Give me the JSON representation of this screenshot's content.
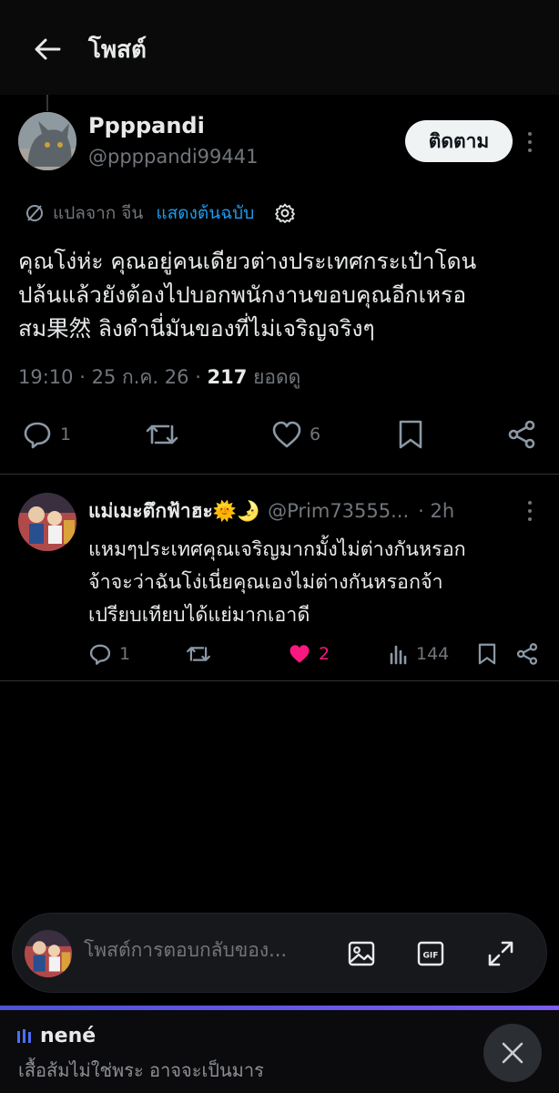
{
  "header": {
    "title": "โพสต์",
    "back_icon": "arrow-left-icon"
  },
  "post": {
    "author_name": "Ppppandi",
    "author_handle": "@ppppandi99441",
    "follow_label": "ติดตาม",
    "translate": {
      "from_label": "แปลจาก จีน",
      "show_original_label": "แสดงต้นฉบับ"
    },
    "text": "คุณโง่ห่ะ คุณอยู่คนเดียวต่างประเทศกระเป๋าโดน\nปล้นแล้วยังต้องไปบอกพนักงานขอบคุณอีกเหรอ\nสม果然 ลิงดำนี่มันของที่ไม่เจริญจริงๆ",
    "time": "19:10",
    "date": "25 ก.ค. 26",
    "views_count": "217",
    "views_label": "ยอดดู",
    "actions": {
      "reply_count": "1",
      "like_count": "6"
    }
  },
  "reply": {
    "author_name": "แม่เมะตึกฟ้าฮะ🌞🌛",
    "author_handle": "@Prim73555...",
    "time": "· 2h",
    "text": "แหมๆประเทศคุณเจริญมากมั้งไม่ต่างกันหรอก\nจ้าจะว่าฉันโง่เนี่ยคุณเองไม่ต่างกันหรอกจ้า\nเปรียบเทียบได้แย่มากเอาดี",
    "reply_count": "1",
    "like_count": "2",
    "views_count": "144",
    "like_color": "#f91880"
  },
  "composer": {
    "placeholder": "โพสต์การตอบกลับของ..."
  },
  "music": {
    "app_name": "nené",
    "track": "เสื้อส้มไม่ใช่พระ อาจจะเป็นมาร"
  },
  "colors": {
    "accent_blue": "#1d9bf0",
    "background": "#000000",
    "muted_text": "#71767b"
  }
}
